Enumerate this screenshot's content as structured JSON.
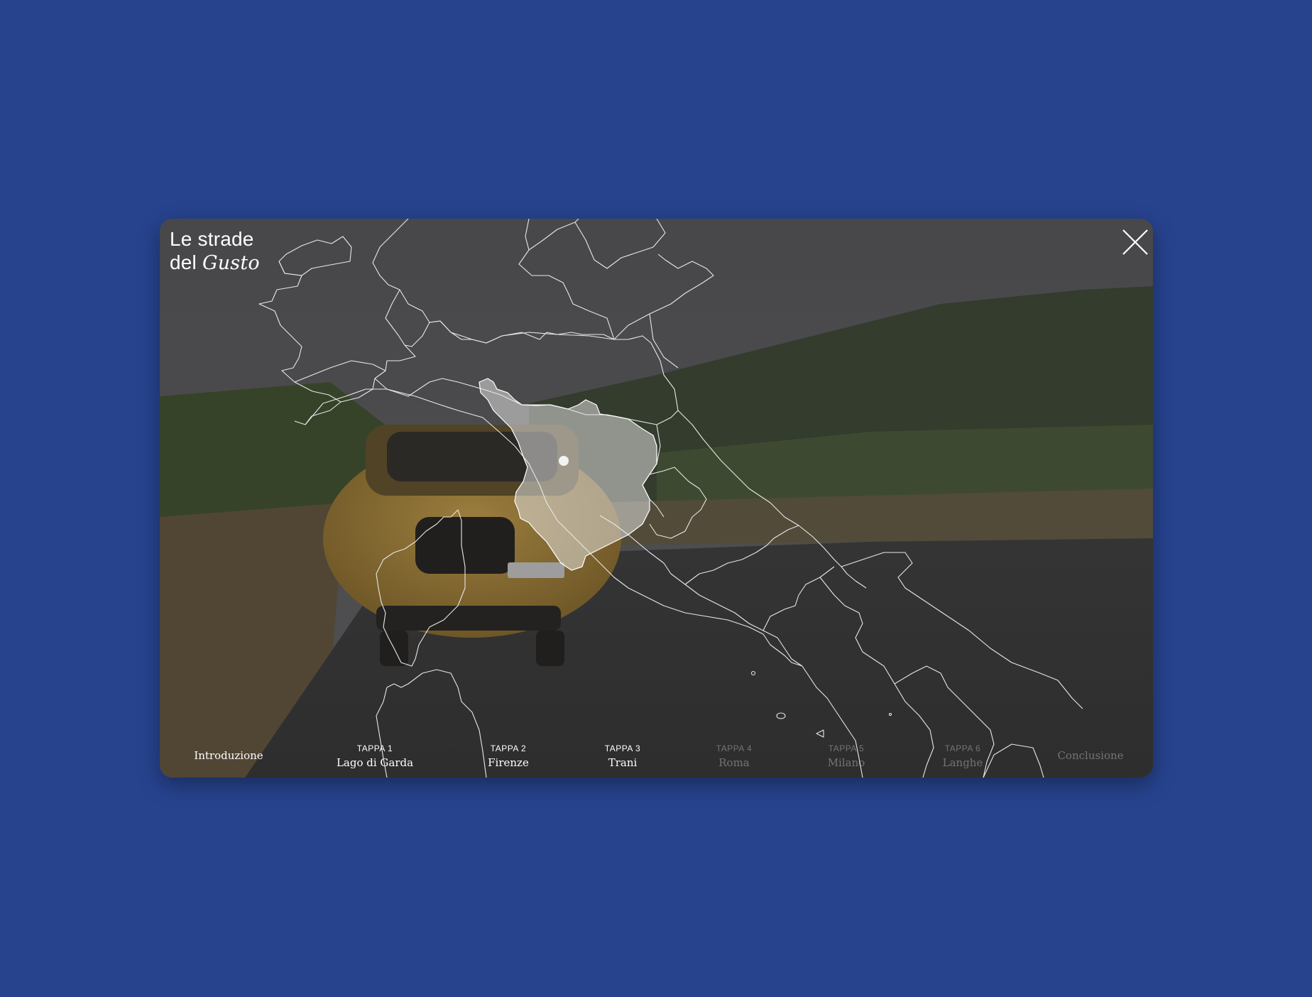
{
  "brand": {
    "line1": "Le strade",
    "line2_prefix": "del",
    "line2_italic": "Gusto"
  },
  "close": {
    "icon": "close-icon"
  },
  "map": {
    "highlighted_region": "Toscana",
    "marker": "Firenze"
  },
  "nav": {
    "intro": "Introduzione",
    "stages": [
      {
        "tag": "TAPPA 1",
        "place": "Lago di Garda",
        "state": "visited"
      },
      {
        "tag": "TAPPA 2",
        "place": "Firenze",
        "state": "current"
      },
      {
        "tag": "TAPPA 3",
        "place": "Trani",
        "state": "visited"
      },
      {
        "tag": "TAPPA 4",
        "place": "Roma",
        "state": "upcoming"
      },
      {
        "tag": "TAPPA 5",
        "place": "Milano",
        "state": "upcoming"
      },
      {
        "tag": "TAPPA 6",
        "place": "Langhe",
        "state": "upcoming"
      }
    ],
    "outro": "Conclusione"
  },
  "colors": {
    "background": "#27438e",
    "text": "#ffffff",
    "car": "#d9a83a"
  }
}
